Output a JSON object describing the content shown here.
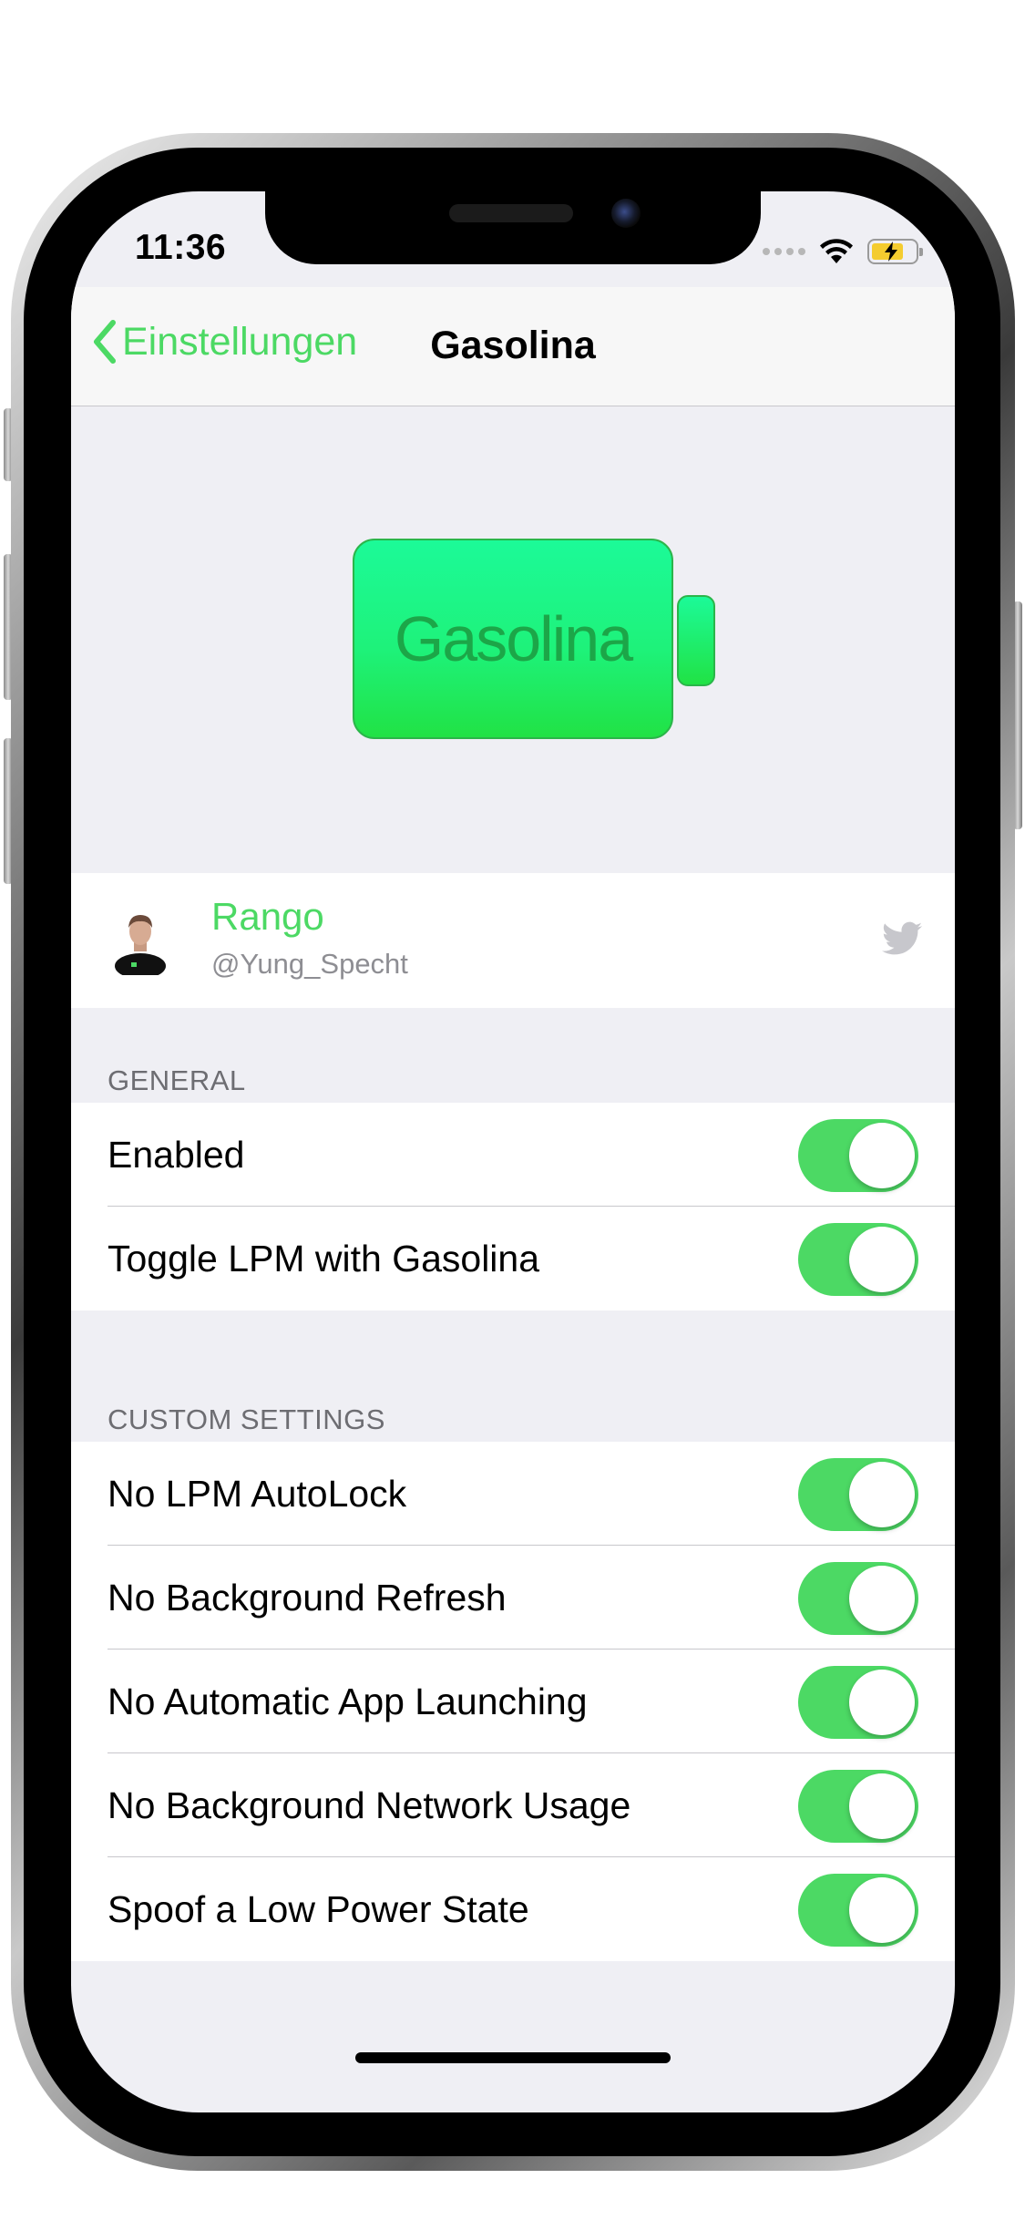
{
  "status_bar": {
    "time": "11:36"
  },
  "nav": {
    "back_label": "Einstellungen",
    "title": "Gasolina"
  },
  "header": {
    "logo_text": "Gasolina"
  },
  "author": {
    "name": "Rango",
    "handle": "@Yung_Specht"
  },
  "sections": [
    {
      "title": "GENERAL",
      "rows": [
        {
          "label": "Enabled",
          "on": true
        },
        {
          "label": "Toggle LPM with Gasolina",
          "on": true
        }
      ]
    },
    {
      "title": "CUSTOM SETTINGS",
      "rows": [
        {
          "label": "No LPM AutoLock",
          "on": true
        },
        {
          "label": "No Background Refresh",
          "on": true
        },
        {
          "label": "No Automatic App Launching",
          "on": true
        },
        {
          "label": "No Background Network Usage",
          "on": true
        },
        {
          "label": "Spoof a Low Power State",
          "on": true
        }
      ]
    }
  ],
  "colors": {
    "accent": "#4cd964",
    "background": "#efeff4"
  },
  "icons": [
    "chevron-left-icon",
    "wifi-icon",
    "battery-charging-icon",
    "twitter-icon",
    "avatar"
  ]
}
